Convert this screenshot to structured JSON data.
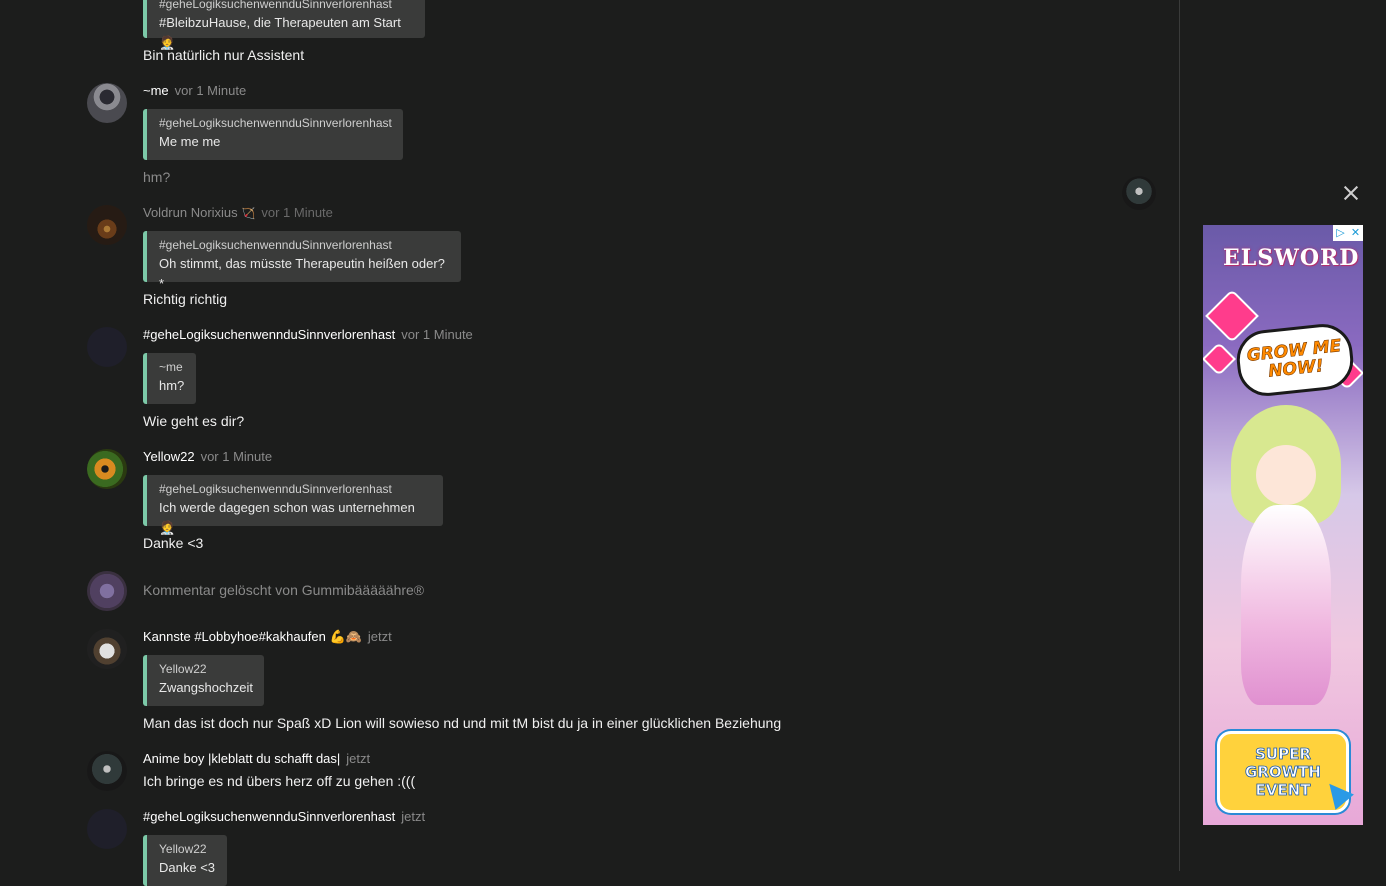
{
  "messages": [
    {
      "quote_author": "#geheLogiksuchenwennduSinnverlorenhast",
      "quote_text": "#BleibzuHause, die Therapeuten am Start🧑‍⚕️",
      "text": "Bin natürlich nur Assistent"
    },
    {
      "author": "~me",
      "time": "vor 1 Minute",
      "avatar": "me-avatar",
      "quote_author": "#geheLogiksuchenwennduSinnverlorenhast",
      "quote_text": "Me me me",
      "text": "hm?"
    },
    {
      "author": "Voldrun Norixius",
      "author_deco": "🏹",
      "time": "vor 1 Minute",
      "quote_author": "#geheLogiksuchenwennduSinnverlorenhast",
      "quote_text": "Oh stimmt, das müsste Therapeutin heißen oder?*",
      "text": "Richtig richtig"
    },
    {
      "author": "#geheLogiksuchenwennduSinnverlorenhast",
      "time": "vor 1 Minute",
      "quote_author": "~me",
      "quote_text": "hm?",
      "text": "Wie geht es dir?"
    },
    {
      "author": "Yellow22",
      "time": "vor 1 Minute",
      "quote_author": "#geheLogiksuchenwennduSinnverlorenhast",
      "quote_text": "Ich werde dagegen schon was unternehmen 🧑‍⚕️",
      "text": "Danke <3"
    },
    {
      "deleted_text": "Kommentar gelöscht von Gummibääääähre®"
    },
    {
      "author": "Kannste #Lobbyhoe#kakhaufen 💪🙈",
      "time": "jetzt",
      "quote_author": "Yellow22",
      "quote_text": "Zwangshochzeit",
      "text": "Man das ist doch nur Spaß xD Lion will sowieso nd und mit tM bist du ja in einer glücklichen Beziehung"
    },
    {
      "author": "Anime boy |kleblatt du schafft das|",
      "time": "jetzt",
      "text": "Ich bringe es nd übers herz off zu gehen :((("
    },
    {
      "author": "#geheLogiksuchenwennduSinnverlorenhast",
      "time": "jetzt",
      "quote_author": "Yellow22",
      "quote_text": "Danke <3"
    }
  ],
  "ad": {
    "adchoices": [
      "▷",
      "✕"
    ],
    "logo": "ELSWORD",
    "bubble": "GROW ME NOW!",
    "cta": "SUPER GROWTH EVENT"
  },
  "icons": {
    "close": "close-icon"
  }
}
